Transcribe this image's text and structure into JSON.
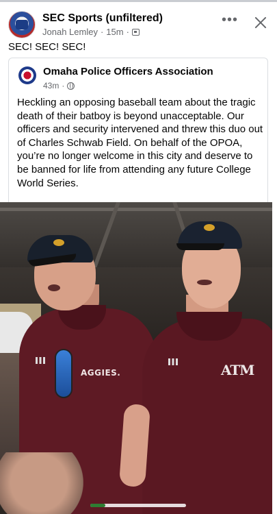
{
  "post": {
    "page_name": "SEC Sports (unfiltered)",
    "author": "Jonah Lemley",
    "time": "15m",
    "dot": "·",
    "text": "SEC! SEC! SEC!"
  },
  "shared": {
    "org_name": "Omaha Police Officers Association",
    "time": "43m",
    "dot": "·",
    "body": "Heckling an opposing baseball team about the tragic death of their batboy is beyond unacceptable. Our officers and security intervened and threw this duo out of Charles Schwab Field. On behalf of the OPOA, you’re no longer welcome in this city and deserve to be banned for life from attending any future College World Series."
  },
  "photo": {
    "shirt_text_left": "AGGIES.",
    "shirt_logo_right": "ATM"
  },
  "icons": {
    "more": "more-icon",
    "close": "close-icon",
    "privacy": "friends-privacy-icon",
    "public": "globe-icon"
  },
  "colors": {
    "secondary_text": "#65676b",
    "maroon": "#5e1a24"
  }
}
